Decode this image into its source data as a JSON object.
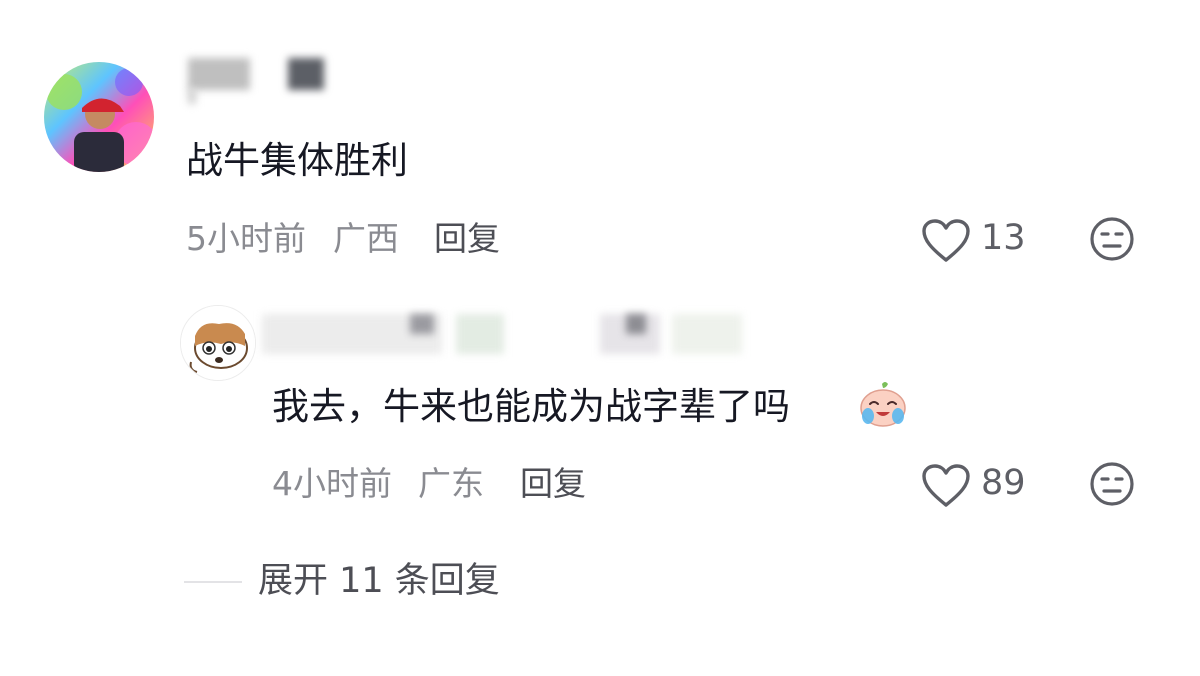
{
  "comment": {
    "text": "战牛集体胜利",
    "time": "5小时前",
    "location": "广西",
    "reply_label": "回复",
    "like_count": "13"
  },
  "reply": {
    "text": "我去，牛来也能成为战字辈了吗",
    "time": "4小时前",
    "location": "广东",
    "reply_label": "回复",
    "like_count": "89",
    "emoji_icon": "crying-face-emoji-icon"
  },
  "expand": {
    "label": "展开 11 条回复"
  },
  "icons": {
    "like": "heart-outline-icon",
    "dislike": "unamused-face-icon"
  },
  "colors": {
    "meta_text": "#8a8b91",
    "primary_text": "#161823",
    "icon_stroke": "#5e5f66"
  }
}
